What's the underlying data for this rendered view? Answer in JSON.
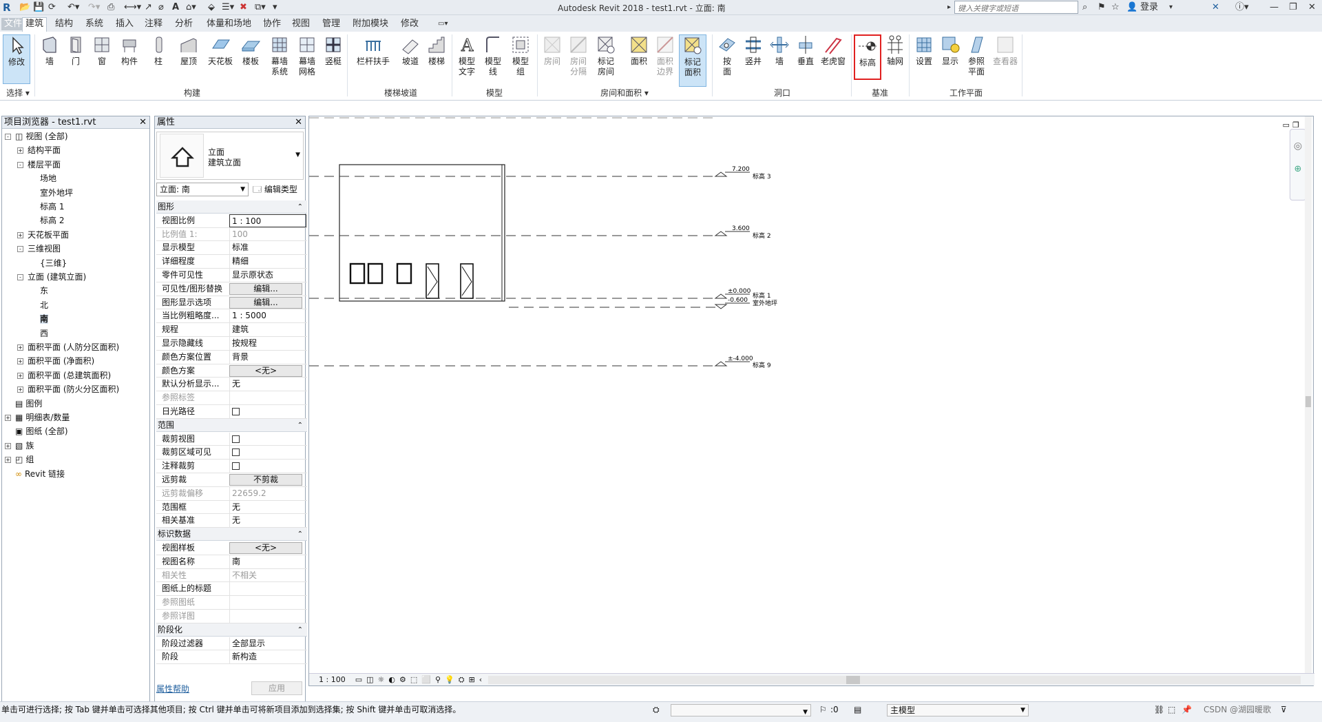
{
  "app": {
    "title": "Autodesk Revit 2018 -    test1.rvt - 立面: 南"
  },
  "titlebar": {
    "search_placeholder": "键入关键字或短语",
    "login_label": "登录"
  },
  "tabs": [
    "文件",
    "建筑",
    "结构",
    "系统",
    "插入",
    "注释",
    "分析",
    "体量和场地",
    "协作",
    "视图",
    "管理",
    "附加模块",
    "修改"
  ],
  "active_tab": "建筑",
  "ribbon": {
    "select_panel": {
      "modify_label": "修改",
      "panel_label": "选择 ▾"
    },
    "build": {
      "items": [
        "墙",
        "门",
        "窗",
        "构件",
        "柱",
        "屋顶",
        "天花板",
        "楼板",
        "幕墙\n系统",
        "幕墙\n网格",
        "竖梃"
      ],
      "panel_label": "构建"
    },
    "circulation": {
      "items": [
        "栏杆扶手",
        "坡道",
        "楼梯"
      ],
      "panel_label": "楼梯坡道"
    },
    "model": {
      "items": [
        "模型\n文字",
        "模型\n线",
        "模型\n组"
      ],
      "panel_label": "模型"
    },
    "room_area": {
      "items": [
        "房间",
        "房间\n分隔",
        "标记\n房间",
        "面积",
        "面积\n边界",
        "标记\n面积"
      ],
      "panel_label": "房间和面积 ▾"
    },
    "opening": {
      "items": [
        "按\n面",
        "竖井",
        "墙",
        "垂直",
        "老虎窗"
      ],
      "panel_label": "洞口"
    },
    "datum": {
      "items": [
        "标高",
        "轴网"
      ],
      "panel_label": "基准"
    },
    "workplane": {
      "items": [
        "设置",
        "显示",
        "参照\n平面",
        "查看器"
      ],
      "panel_label": "工作平面"
    }
  },
  "browser": {
    "title": "项目浏览器 - test1.rvt",
    "rows": [
      {
        "toggle": "-",
        "label": "视图 (全部)",
        "level": 0,
        "icon": "views-icon"
      },
      {
        "toggle": "+",
        "label": "结构平面",
        "level": 1
      },
      {
        "toggle": "-",
        "label": "楼层平面",
        "level": 1
      },
      {
        "toggle": "",
        "label": "场地",
        "level": 2
      },
      {
        "toggle": "",
        "label": "室外地坪",
        "level": 2
      },
      {
        "toggle": "",
        "label": "标高 1",
        "level": 2
      },
      {
        "toggle": "",
        "label": "标高 2",
        "level": 2
      },
      {
        "toggle": "+",
        "label": "天花板平面",
        "level": 1
      },
      {
        "toggle": "-",
        "label": "三维视图",
        "level": 1
      },
      {
        "toggle": "",
        "label": "{三维}",
        "level": 2
      },
      {
        "toggle": "-",
        "label": "立面 (建筑立面)",
        "level": 1
      },
      {
        "toggle": "",
        "label": "东",
        "level": 2
      },
      {
        "toggle": "",
        "label": "北",
        "level": 2
      },
      {
        "toggle": "",
        "label": "南",
        "level": 2,
        "bold": true
      },
      {
        "toggle": "",
        "label": "西",
        "level": 2
      },
      {
        "toggle": "+",
        "label": "面积平面 (人防分区面积)",
        "level": 1
      },
      {
        "toggle": "+",
        "label": "面积平面 (净面积)",
        "level": 1
      },
      {
        "toggle": "+",
        "label": "面积平面 (总建筑面积)",
        "level": 1
      },
      {
        "toggle": "+",
        "label": "面积平面 (防火分区面积)",
        "level": 1
      },
      {
        "toggle": "",
        "label": "图例",
        "level": 0,
        "icon": "legend-icon"
      },
      {
        "toggle": "+",
        "label": "明细表/数量",
        "level": 0,
        "icon": "schedule-icon"
      },
      {
        "toggle": "",
        "label": "图纸 (全部)",
        "level": 0,
        "icon": "sheet-icon"
      },
      {
        "toggle": "+",
        "label": "族",
        "level": 0,
        "icon": "family-icon"
      },
      {
        "toggle": "+",
        "label": "组",
        "level": 0,
        "icon": "group-icon"
      },
      {
        "toggle": "",
        "label": "Revit 链接",
        "level": 0,
        "icon": "link-icon"
      }
    ]
  },
  "properties": {
    "title": "属性",
    "type_name": "立面",
    "type_sub": "建筑立面",
    "selector": "立面: 南",
    "edit_type": "编辑类型",
    "groups": [
      {
        "name": "图形",
        "rows": [
          {
            "k": "视图比例",
            "v": "1 : 100",
            "input": true
          },
          {
            "k": "比例值 1:",
            "v": "100",
            "grey": true
          },
          {
            "k": "显示模型",
            "v": "标准"
          },
          {
            "k": "详细程度",
            "v": "精细"
          },
          {
            "k": "零件可见性",
            "v": "显示原状态"
          },
          {
            "k": "可见性/图形替换",
            "v": "编辑...",
            "button": true
          },
          {
            "k": "图形显示选项",
            "v": "编辑...",
            "button": true
          },
          {
            "k": "当比例粗略度...",
            "v": "1 : 5000"
          },
          {
            "k": "规程",
            "v": "建筑"
          },
          {
            "k": "显示隐藏线",
            "v": "按规程"
          },
          {
            "k": "颜色方案位置",
            "v": "背景"
          },
          {
            "k": "颜色方案",
            "v": "<无>",
            "button": true
          },
          {
            "k": "默认分析显示...",
            "v": "无"
          },
          {
            "k": "参照标签",
            "v": "",
            "grey": true
          },
          {
            "k": "日光路径",
            "v": "",
            "checkbox": true
          }
        ]
      },
      {
        "name": "范围",
        "rows": [
          {
            "k": "裁剪视图",
            "v": "",
            "checkbox": true
          },
          {
            "k": "裁剪区域可见",
            "v": "",
            "checkbox": true
          },
          {
            "k": "注释裁剪",
            "v": "",
            "checkbox": true
          },
          {
            "k": "远剪裁",
            "v": "不剪裁",
            "button": true
          },
          {
            "k": "远剪裁偏移",
            "v": "22659.2",
            "grey": true
          },
          {
            "k": "范围框",
            "v": "无"
          },
          {
            "k": "相关基准",
            "v": "无"
          }
        ]
      },
      {
        "name": "标识数据",
        "rows": [
          {
            "k": "视图样板",
            "v": "<无>",
            "button": true
          },
          {
            "k": "视图名称",
            "v": "南"
          },
          {
            "k": "相关性",
            "v": "不相关",
            "grey": true
          },
          {
            "k": "图纸上的标题",
            "v": ""
          },
          {
            "k": "参照图纸",
            "v": "",
            "grey": true
          },
          {
            "k": "参照详图",
            "v": "",
            "grey": true
          }
        ]
      },
      {
        "name": "阶段化",
        "rows": [
          {
            "k": "阶段过滤器",
            "v": "全部显示"
          },
          {
            "k": "阶段",
            "v": "新构造"
          }
        ]
      }
    ],
    "help": "属性帮助",
    "apply": "应用"
  },
  "canvas": {
    "levels": [
      {
        "name": "标高 3",
        "elev": "7.200"
      },
      {
        "name": "标高 2",
        "elev": "3.600"
      },
      {
        "name": "标高 1",
        "elev": "±0.000"
      },
      {
        "name": "室外地坪",
        "elev": "-0.600"
      },
      {
        "name": "标高 9",
        "elev": "±-4.000"
      }
    ],
    "scale": "1 : 100"
  },
  "status": {
    "message": "单击可进行选择; 按 Tab 键并单击可选择其他项目; 按 Ctrl 键并单击可将新项目添加到选择集; 按 Shift 键并单击可取消选择。",
    "coord": ":0",
    "model": "主模型",
    "watermark": "CSDN @湖园暖歌"
  },
  "colors": {
    "accent": "#1f5f9e",
    "highlight_box": "#e02020",
    "active_button_bg": "#c8e4f8"
  }
}
